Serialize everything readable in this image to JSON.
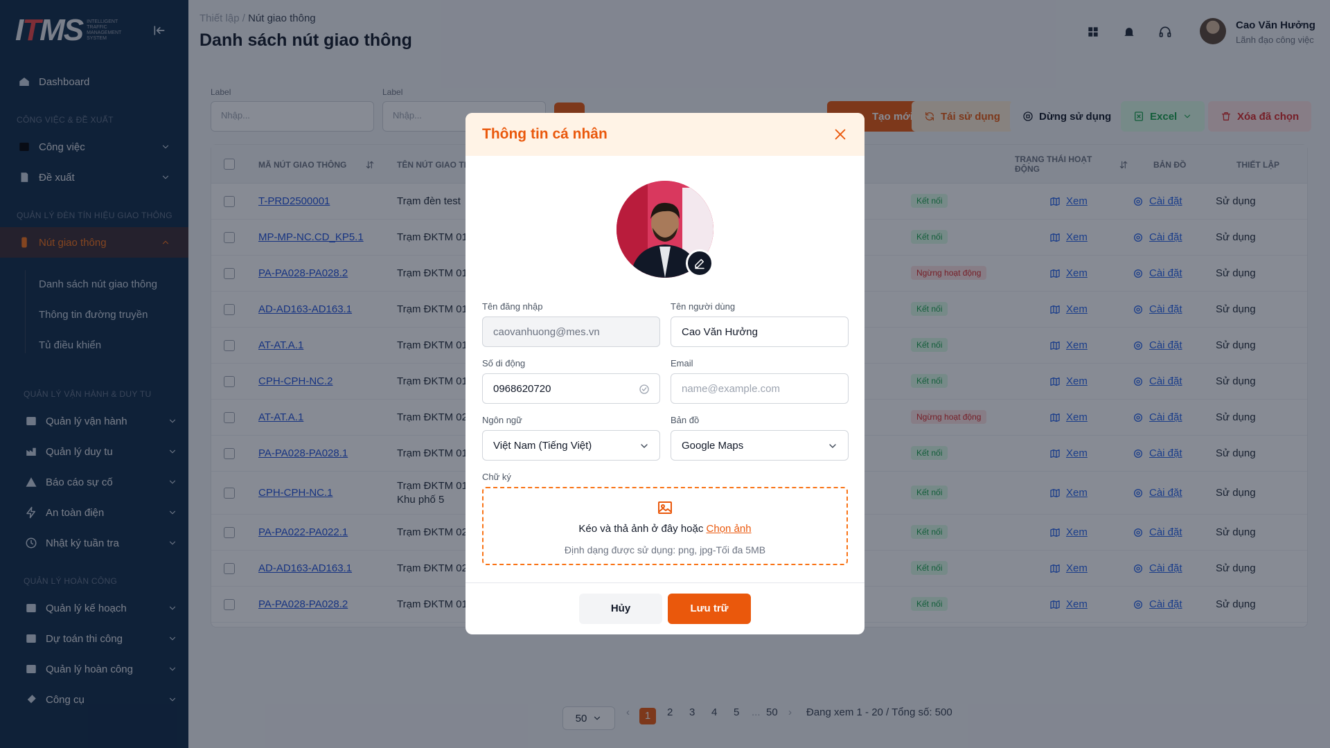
{
  "app": {
    "logo_main": "ITMS",
    "logo_sub": "INTELLIGENT TRAFFIC MANAGEMENT SYSTEM"
  },
  "sidebar": {
    "dashboard": "Dashboard",
    "section_1": "CÔNG VIỆC & ĐỀ XUẤT",
    "cong_viec": "Công việc",
    "de_xuat": "Đề xuất",
    "section_2": "QUẢN LÝ ĐÈN TÍN HIỆU GIAO THÔNG",
    "nut_giao_thong": "Nút giao thông",
    "sub_items": [
      "Danh sách nút giao thông",
      "Thông tin đường truyền",
      "Tủ điều khiển"
    ],
    "section_3": "QUẢN LÝ VẬN HÀNH & DUY TU",
    "group_3": [
      "Quản lý vận hành",
      "Quản lý duy tu",
      "Báo cáo sự cố",
      "An toàn điện",
      "Nhật ký tuần tra"
    ],
    "section_4": "QUẢN LÝ HOÀN CÔNG",
    "group_4": [
      "Quản lý kế hoạch",
      "Dự toán thi công",
      "Quản lý hoàn công",
      "Công cụ"
    ]
  },
  "header": {
    "breadcrumb_root": "Thiết lập",
    "breadcrumb_sep": "/",
    "breadcrumb_current": "Nút giao thông",
    "title": "Danh sách nút giao thông",
    "user_name": "Cao Văn Hưởng",
    "user_role": "Lãnh đạo công việc"
  },
  "filters": {
    "label_1": "Label",
    "placeholder_1": "Nhập...",
    "label_2": "Label",
    "placeholder_2": "Nhập...",
    "btn_new": "Tạo mới",
    "btn_reuse": "Tái sử dụng",
    "btn_stop": "Dừng sử dụng",
    "btn_excel": "Excel",
    "btn_delete": "Xóa đã chọn"
  },
  "table": {
    "headers": {
      "code": "MÃ NÚT GIAO THÔNG",
      "name": "TÊN NÚT GIAO THÔNG",
      "status": "TRẠNG THÁI HOẠT ĐỘNG",
      "map": "BẢN ĐỒ",
      "setup": "THIẾT LẬP"
    },
    "link_view": "Xem",
    "link_setup": "Cài đặt",
    "use_text": "Sử dụng",
    "rows": [
      {
        "code": "T-PRD2500001",
        "name": "Trạm đèn test",
        "status": "Kết nối"
      },
      {
        "code": "MP-MP-NC.CD_KP5.1",
        "name": "Trạm ĐKTM 01",
        "status": "Kết nối"
      },
      {
        "code": "PA-PA028-PA028.2",
        "name": "Trạm ĐKTM 01",
        "status": "Ngừng hoạt động"
      },
      {
        "code": "AD-AD163-AD163.1",
        "name": "Trạm ĐKTM 01",
        "status": "Kết nối"
      },
      {
        "code": "AT-AT.A.1",
        "name": "Trạm ĐKTM 01",
        "status": "Kết nối"
      },
      {
        "code": "CPH-CPH-NC.2",
        "name": "Trạm ĐKTM 01",
        "status": "Kết nối"
      },
      {
        "code": "AT-AT.A.1",
        "name": "Trạm ĐKTM 02",
        "status": "Ngừng hoạt động"
      },
      {
        "code": "PA-PA028-PA028.1",
        "name": "Trạm ĐKTM 01",
        "status": "Kết nối"
      },
      {
        "code": "CPH-CPH-NC.1",
        "name": "Trạm ĐKTM 01",
        "name2": "Khu phố 5",
        "status": "Kết nối"
      },
      {
        "code": "PA-PA022-PA022.1",
        "name": "Trạm ĐKTM 02",
        "status": "Kết nối"
      },
      {
        "code": "AD-AD163-AD163.1",
        "name": "Trạm ĐKTM 02",
        "status": "Kết nối"
      },
      {
        "code": "PA-PA028-PA028.2",
        "name": "Trạm ĐKTM 01",
        "status": "Kết nối"
      }
    ]
  },
  "pagination": {
    "page_size": "50",
    "pages": [
      "1",
      "2",
      "3",
      "4",
      "5"
    ],
    "ellipsis": "...",
    "last": "50",
    "summary": "Đang xem 1 - 20 / Tổng số: 500"
  },
  "modal": {
    "title": "Thông tin cá nhân",
    "username_label": "Tên đăng nhập",
    "username_value": "caovanhuong@mes.vn",
    "fullname_label": "Tên người dùng",
    "fullname_value": "Cao Văn Hưởng",
    "phone_label": "Số di động",
    "phone_value": "0968620720",
    "email_label": "Email",
    "email_placeholder": "name@example.com",
    "lang_label": "Ngôn ngữ",
    "lang_value": "Việt Nam (Tiếng Việt)",
    "map_label": "Bản đồ",
    "map_value": "Google Maps",
    "sig_label": "Chữ ký",
    "drop_text": "Kéo và thả ảnh ở đây hoặc",
    "drop_link": "Chọn ảnh",
    "drop_hint": "Định dạng được sử dụng: png, jpg-Tối đa 5MB",
    "cancel": "Hủy",
    "save": "Lưu trữ"
  },
  "colors": {
    "accent": "#ea580c",
    "sidebar_bg": "#0f2a47",
    "ok": "#16a34a",
    "bad": "#dc2626"
  }
}
